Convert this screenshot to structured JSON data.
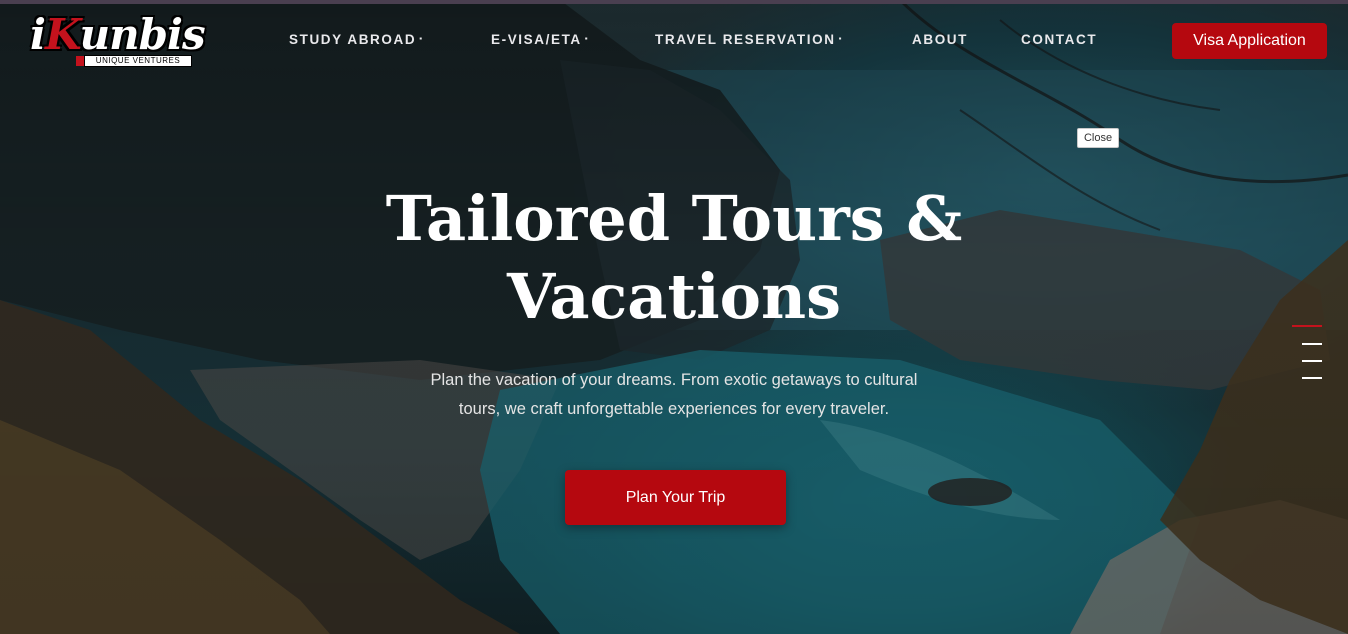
{
  "brand": {
    "name_prefix": "i",
    "name_k": "K",
    "name_rest": "unbis",
    "tagline": "UNIQUE VENTURES"
  },
  "nav": {
    "items": [
      {
        "label": "STUDY ABROAD",
        "has_dropdown": true
      },
      {
        "label": "E-VISA/ETA",
        "has_dropdown": true
      },
      {
        "label": "TRAVEL RESERVATION",
        "has_dropdown": true
      },
      {
        "label": "ABOUT",
        "has_dropdown": false
      },
      {
        "label": "CONTACT",
        "has_dropdown": false
      }
    ],
    "caret": "▪"
  },
  "header": {
    "cta_label": "Visa Application"
  },
  "tooltip": {
    "close_label": "Close"
  },
  "hero": {
    "title_line1": "Tailored Tours &",
    "title_line2": "Vacations",
    "subtitle_line1": "Plan the vacation of your dreams. From exotic getaways to cultural",
    "subtitle_line2": "tours, we craft unforgettable experiences for every traveler.",
    "cta_label": "Plan Your Trip"
  },
  "slider": {
    "active_index": 0,
    "count": 4
  },
  "colors": {
    "accent": "#b5080f",
    "text_light": "#ffffff",
    "nav_text": "#e9e9ec"
  }
}
